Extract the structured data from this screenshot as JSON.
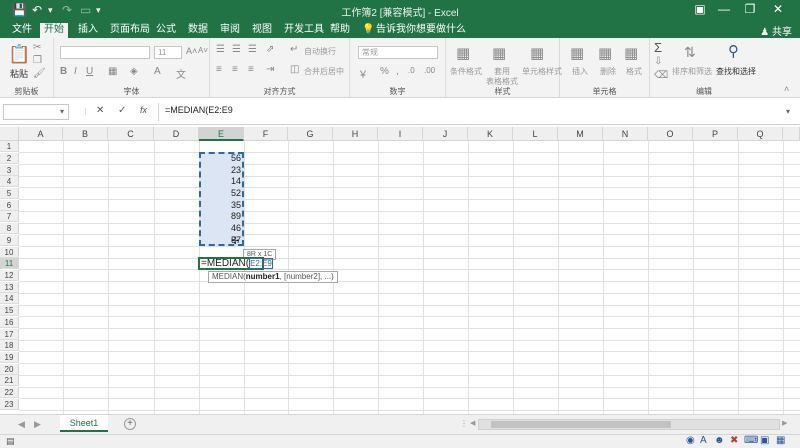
{
  "titlebar": {
    "title": "工作簿2  [兼容模式]  -  Excel",
    "save_icon": "save-icon",
    "undo_icon": "undo-icon",
    "redo_icon": "redo-icon"
  },
  "menu": {
    "tabs": [
      "文件",
      "开始",
      "插入",
      "页面布局",
      "公式",
      "数据",
      "审阅",
      "视图",
      "开发工具",
      "帮助"
    ],
    "active": "开始",
    "tell_me": "告诉我你想要做什么",
    "share": "共享"
  },
  "ribbon": {
    "groups": [
      "剪贴板",
      "字体",
      "对齐方式",
      "数字",
      "样式",
      "单元格",
      "编辑"
    ],
    "paste_label": "粘贴",
    "font_size": "11",
    "wrap_text": "自动换行",
    "merge_center": "合并后居中",
    "number_format": "常规",
    "conditional_format": "条件格式",
    "table_format_1": "套用",
    "table_format_2": "表格格式",
    "cell_styles": "单元格样式",
    "insert": "插入",
    "delete": "删除",
    "format": "格式",
    "sort_filter": "排序和筛选",
    "find_select": "查找和选择"
  },
  "formula_bar": {
    "name_box": "",
    "cancel": "✕",
    "enter": "✓",
    "fx": "fx",
    "content": "=MEDIAN(E2:E9"
  },
  "grid": {
    "columns": [
      "A",
      "B",
      "C",
      "D",
      "E",
      "F",
      "G",
      "H",
      "I",
      "J",
      "K",
      "L",
      "M",
      "N",
      "O",
      "P",
      "Q"
    ],
    "selected_column": "E",
    "rows": [
      "1",
      "2",
      "3",
      "4",
      "5",
      "6",
      "7",
      "8",
      "9",
      "10",
      "11",
      "12",
      "13",
      "14",
      "15",
      "16",
      "17",
      "18",
      "19",
      "20",
      "21",
      "22",
      "23"
    ],
    "selected_row": "11",
    "values_e": [
      "56",
      "23",
      "14",
      "52",
      "35",
      "89",
      "46",
      "57"
    ],
    "editing_cell_text": "=MEDIAN(",
    "editing_ref": "E2:E9",
    "range_tooltip": "8R x 1C",
    "function_tip": {
      "name": "MEDIAN(",
      "arg1": "number1",
      "rest": ", [number2], ...)"
    }
  },
  "sheet_tabs": {
    "active": "Sheet1",
    "add": "+"
  },
  "colors": {
    "accent": "#217346",
    "selection_fill": "#dbe5f4"
  }
}
